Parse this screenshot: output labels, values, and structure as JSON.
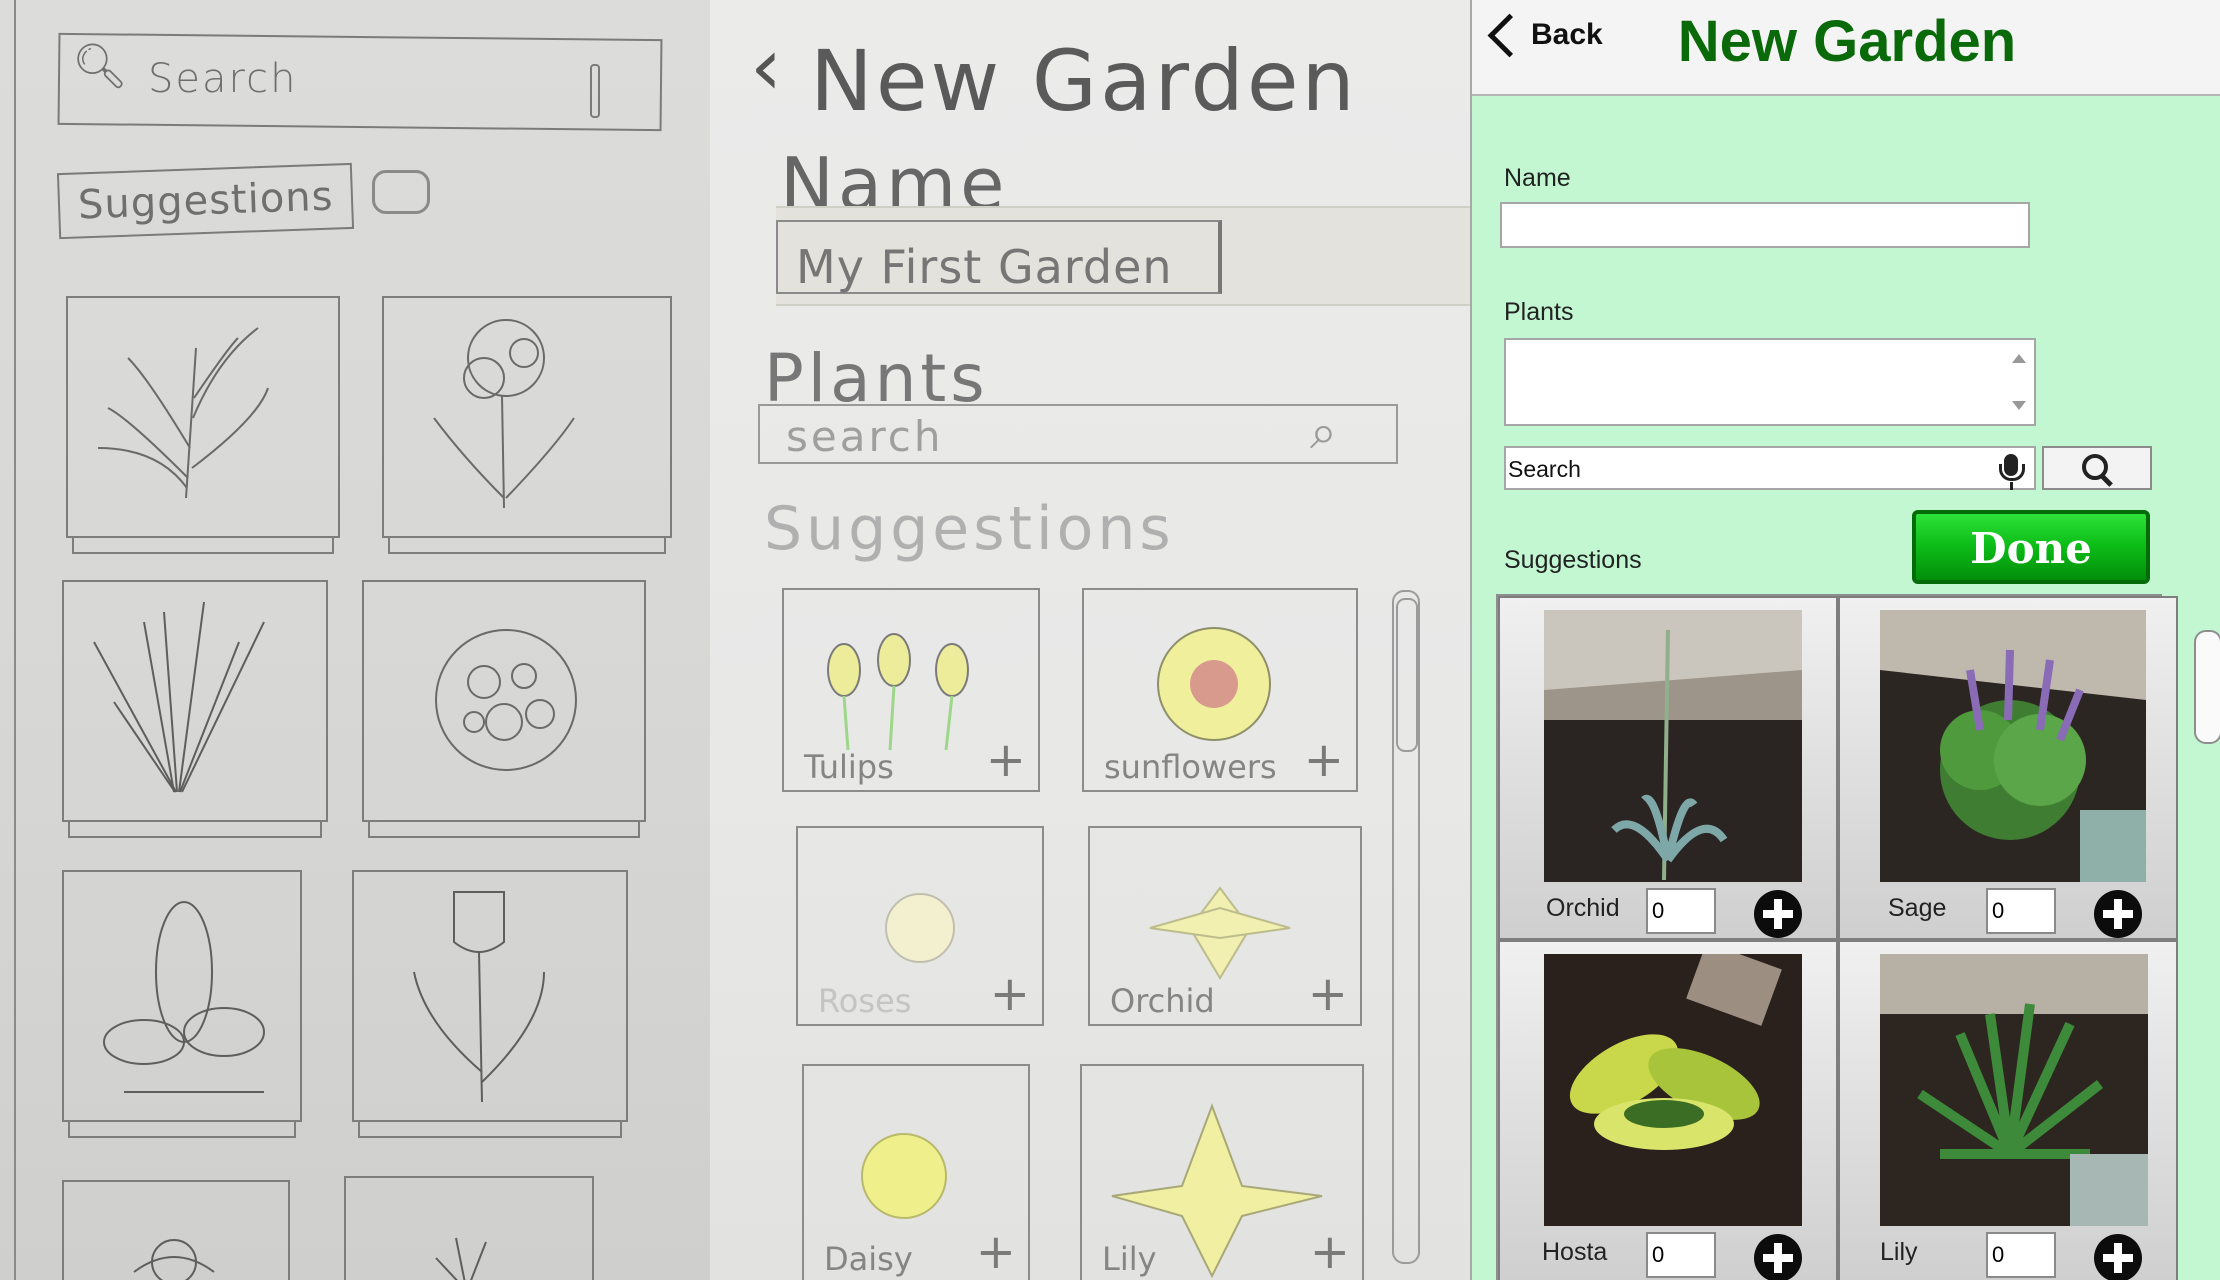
{
  "sketch1": {
    "search_text": "Search",
    "suggestions_label": "Suggestions"
  },
  "sketch2": {
    "title": "New Garden",
    "name_label": "Name",
    "name_value": "My First Garden",
    "plants_label": "Plants",
    "search_text": "search",
    "suggestions_label": "Suggestions",
    "tiles": [
      "Tulips",
      "sunflowers",
      "Roses",
      "Orchid",
      "Daisy",
      "Lily"
    ]
  },
  "app": {
    "back_label": "Back",
    "title": "New Garden",
    "name_label": "Name",
    "name_value": "",
    "plants_label": "Plants",
    "search_text": "Search",
    "done_label": "Done",
    "suggestions_label": "Suggestions",
    "plants": [
      {
        "name": "Orchid",
        "qty": "0"
      },
      {
        "name": "Sage",
        "qty": "0"
      },
      {
        "name": "Hosta",
        "qty": "0"
      },
      {
        "name": "Lily",
        "qty": "0"
      }
    ],
    "colors": {
      "background": "#c2f7d2",
      "title": "#0a6a0a",
      "done": "#0dbf18"
    }
  }
}
